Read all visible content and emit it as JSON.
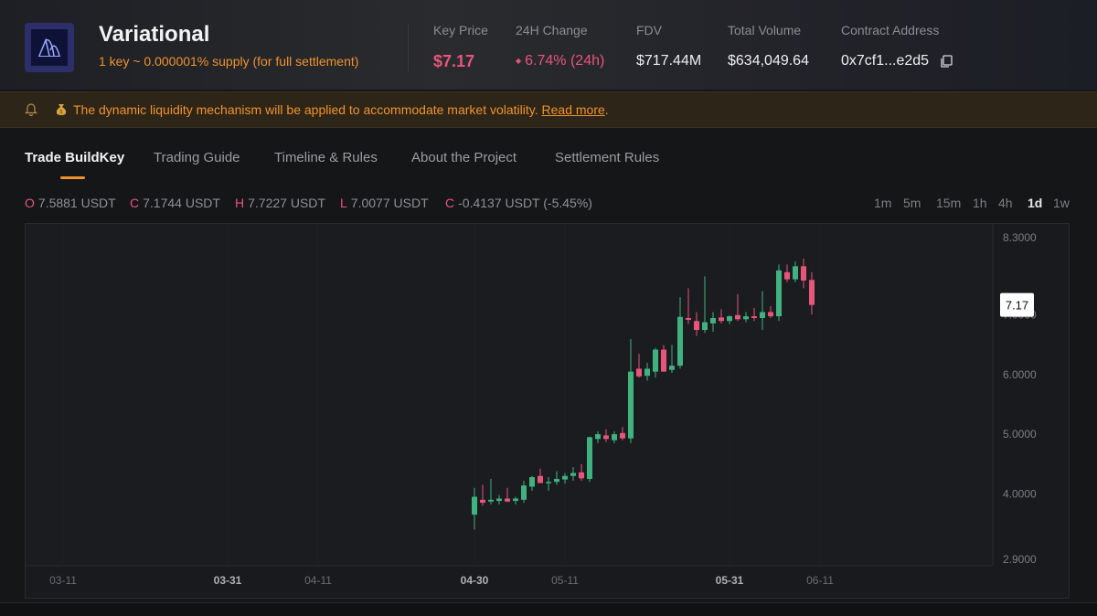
{
  "header": {
    "title": "Variational",
    "subtitle": "1 key ~ 0.000001% supply (for full settlement)",
    "key_price_label": "Key Price",
    "key_price": "$7.17",
    "change_label": "24H Change",
    "change_value": "6.74% (24h)",
    "fdv_label": "FDV",
    "fdv_value": "$717.44M",
    "volume_label": "Total Volume",
    "volume_value": "$634,049.64",
    "contract_label": "Contract Address",
    "contract_value": "0x7cf1...e2d5"
  },
  "notice": {
    "text": "The dynamic liquidity mechanism will be applied to accommodate market volatility.",
    "link": "Read more",
    "end": "."
  },
  "tabs": [
    "Trade BuildKey",
    "Trading Guide",
    "Timeline & Rules",
    "About the Project",
    "Settlement Rules"
  ],
  "ohlc": {
    "o_key": "O",
    "o_val": "7.5881 USDT",
    "c_key": "C",
    "c_val": "7.1744 USDT",
    "h_key": "H",
    "h_val": "7.7227 USDT",
    "l_key": "L",
    "l_val": "7.0077 USDT",
    "ch_key": "C",
    "ch_val": "-0.4137 USDT (-5.45%)"
  },
  "timeframes": [
    "1m",
    "5m",
    "15m",
    "1h",
    "4h",
    "1d",
    "1w"
  ],
  "active_timeframe": "1d",
  "colors": {
    "up": "#3fb27f",
    "down": "#e8557a",
    "accent": "#f0922d"
  },
  "chart_data": {
    "type": "candlestick",
    "last_price_label": "7.17",
    "y_ticks": [
      "8.3000",
      "7.0000",
      "6.0000",
      "5.0000",
      "4.0000",
      "2.9000"
    ],
    "y_tick_values": [
      8.3,
      7.0,
      6.0,
      5.0,
      4.0,
      2.9
    ],
    "ylim": [
      2.9,
      8.3
    ],
    "x_ticks": [
      {
        "label": "03-11",
        "bold": false
      },
      {
        "label": "03-31",
        "bold": true
      },
      {
        "label": "04-11",
        "bold": false
      },
      {
        "label": "04-30",
        "bold": true
      },
      {
        "label": "05-11",
        "bold": false
      },
      {
        "label": "05-31",
        "bold": true
      },
      {
        "label": "06-11",
        "bold": false
      }
    ],
    "x_tick_days": [
      0,
      20,
      31,
      50,
      61,
      81,
      92
    ],
    "candle_start_day": 50,
    "candles": [
      {
        "o": 3.65,
        "h": 4.1,
        "l": 3.4,
        "c": 3.95
      },
      {
        "o": 3.9,
        "h": 4.15,
        "l": 3.8,
        "c": 3.85
      },
      {
        "o": 3.87,
        "h": 4.25,
        "l": 3.82,
        "c": 3.9
      },
      {
        "o": 3.88,
        "h": 3.98,
        "l": 3.82,
        "c": 3.92
      },
      {
        "o": 3.92,
        "h": 4.1,
        "l": 3.86,
        "c": 3.87
      },
      {
        "o": 3.88,
        "h": 3.95,
        "l": 3.82,
        "c": 3.92
      },
      {
        "o": 3.9,
        "h": 4.22,
        "l": 3.85,
        "c": 4.14
      },
      {
        "o": 4.12,
        "h": 4.3,
        "l": 4.05,
        "c": 4.28
      },
      {
        "o": 4.3,
        "h": 4.42,
        "l": 4.2,
        "c": 4.18
      },
      {
        "o": 4.18,
        "h": 4.28,
        "l": 4.05,
        "c": 4.2
      },
      {
        "o": 4.2,
        "h": 4.38,
        "l": 4.15,
        "c": 4.25
      },
      {
        "o": 4.24,
        "h": 4.35,
        "l": 4.17,
        "c": 4.3
      },
      {
        "o": 4.3,
        "h": 4.45,
        "l": 4.22,
        "c": 4.35
      },
      {
        "o": 4.36,
        "h": 4.5,
        "l": 4.22,
        "c": 4.26
      },
      {
        "o": 4.25,
        "h": 4.96,
        "l": 4.2,
        "c": 4.95
      },
      {
        "o": 4.92,
        "h": 5.05,
        "l": 4.85,
        "c": 5.0
      },
      {
        "o": 4.98,
        "h": 5.08,
        "l": 4.87,
        "c": 4.92
      },
      {
        "o": 4.9,
        "h": 5.05,
        "l": 4.85,
        "c": 5.0
      },
      {
        "o": 5.02,
        "h": 5.12,
        "l": 4.9,
        "c": 4.93
      },
      {
        "o": 4.93,
        "h": 6.6,
        "l": 4.85,
        "c": 6.05
      },
      {
        "o": 6.1,
        "h": 6.35,
        "l": 5.95,
        "c": 5.97
      },
      {
        "o": 5.98,
        "h": 6.2,
        "l": 5.9,
        "c": 6.1
      },
      {
        "o": 6.05,
        "h": 6.45,
        "l": 5.95,
        "c": 6.42
      },
      {
        "o": 6.42,
        "h": 6.5,
        "l": 6.05,
        "c": 6.05
      },
      {
        "o": 6.08,
        "h": 6.5,
        "l": 6.03,
        "c": 6.15
      },
      {
        "o": 6.15,
        "h": 7.3,
        "l": 6.1,
        "c": 6.97
      },
      {
        "o": 6.95,
        "h": 7.45,
        "l": 6.85,
        "c": 6.92
      },
      {
        "o": 6.9,
        "h": 7.05,
        "l": 6.65,
        "c": 6.75
      },
      {
        "o": 6.75,
        "h": 7.65,
        "l": 6.7,
        "c": 6.88
      },
      {
        "o": 6.86,
        "h": 7.05,
        "l": 6.72,
        "c": 6.95
      },
      {
        "o": 6.96,
        "h": 7.1,
        "l": 6.86,
        "c": 6.9
      },
      {
        "o": 6.9,
        "h": 7.0,
        "l": 6.85,
        "c": 6.98
      },
      {
        "o": 7.0,
        "h": 7.35,
        "l": 6.9,
        "c": 6.93
      },
      {
        "o": 6.93,
        "h": 7.05,
        "l": 6.88,
        "c": 6.98
      },
      {
        "o": 6.98,
        "h": 7.12,
        "l": 6.9,
        "c": 6.95
      },
      {
        "o": 6.95,
        "h": 7.4,
        "l": 6.75,
        "c": 7.05
      },
      {
        "o": 7.05,
        "h": 7.15,
        "l": 6.95,
        "c": 6.98
      },
      {
        "o": 6.98,
        "h": 7.85,
        "l": 6.9,
        "c": 7.75
      },
      {
        "o": 7.72,
        "h": 7.85,
        "l": 7.55,
        "c": 7.6
      },
      {
        "o": 7.6,
        "h": 7.9,
        "l": 7.55,
        "c": 7.82
      },
      {
        "o": 7.82,
        "h": 7.95,
        "l": 7.45,
        "c": 7.58
      },
      {
        "o": 7.59,
        "h": 7.72,
        "l": 7.01,
        "c": 7.17
      }
    ]
  }
}
